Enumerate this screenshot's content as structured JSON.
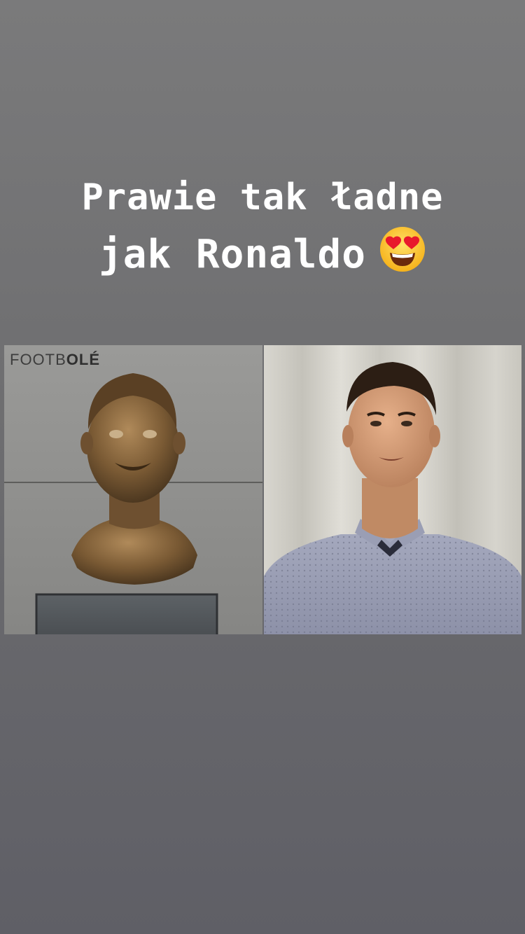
{
  "story": {
    "caption_line1": "Prawie tak ładne",
    "caption_line2": "jak Ronaldo",
    "emoji": "smiling-face-with-heart-eyes"
  },
  "collage": {
    "left_panel": {
      "subject": "bronze-bust",
      "watermark_regular": "FOOTB",
      "watermark_bold": "OLÉ"
    },
    "right_panel": {
      "subject": "person-photo"
    }
  },
  "colors": {
    "background_top": "#7a7a7b",
    "background_bottom": "#5f5f66",
    "caption": "#ffffff"
  }
}
